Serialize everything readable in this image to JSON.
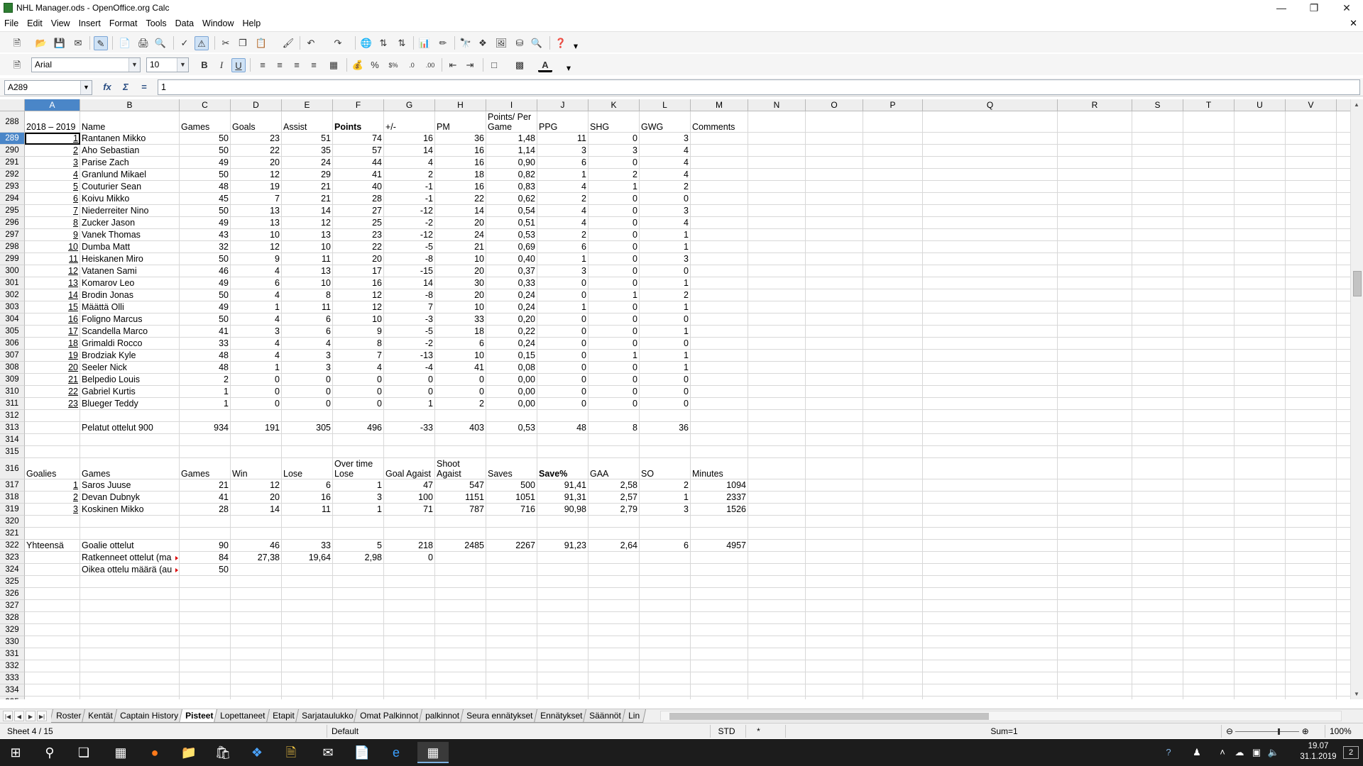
{
  "window": {
    "title": "NHL Manager.ods - OpenOffice.org Calc"
  },
  "menu": [
    "File",
    "Edit",
    "View",
    "Insert",
    "Format",
    "Tools",
    "Data",
    "Window",
    "Help"
  ],
  "format_toolbar": {
    "font_name": "Arial",
    "font_size": "10"
  },
  "formula_bar": {
    "name_box": "A289",
    "content": "1"
  },
  "columns": [
    "A",
    "B",
    "C",
    "D",
    "E",
    "F",
    "G",
    "H",
    "I",
    "J",
    "K",
    "L",
    "M",
    "N",
    "O",
    "P",
    "Q",
    "R",
    "S",
    "T",
    "U",
    "V",
    "W"
  ],
  "rows": [
    {
      "num": "288",
      "cells": [
        "2018 – 2019",
        "Name",
        "Games",
        "Goals",
        "Assist",
        "Points",
        "+/-",
        "PM",
        "Points/ Per Game",
        "PPG",
        "SHG",
        "GWG",
        "Comments"
      ]
    },
    {
      "num": "289",
      "cells": [
        "1",
        "Rantanen Mikko",
        "50",
        "23",
        "51",
        "74",
        "16",
        "36",
        "1,48",
        "11",
        "0",
        "3",
        ""
      ]
    },
    {
      "num": "290",
      "cells": [
        "2",
        "Aho Sebastian",
        "50",
        "22",
        "35",
        "57",
        "14",
        "16",
        "1,14",
        "3",
        "3",
        "4",
        ""
      ]
    },
    {
      "num": "291",
      "cells": [
        "3",
        "Parise Zach",
        "49",
        "20",
        "24",
        "44",
        "4",
        "16",
        "0,90",
        "6",
        "0",
        "4",
        ""
      ]
    },
    {
      "num": "292",
      "cells": [
        "4",
        "Granlund Mikael",
        "50",
        "12",
        "29",
        "41",
        "2",
        "18",
        "0,82",
        "1",
        "2",
        "4",
        ""
      ]
    },
    {
      "num": "293",
      "cells": [
        "5",
        "Couturier Sean",
        "48",
        "19",
        "21",
        "40",
        "-1",
        "16",
        "0,83",
        "4",
        "1",
        "2",
        ""
      ]
    },
    {
      "num": "294",
      "cells": [
        "6",
        "Koivu Mikko",
        "45",
        "7",
        "21",
        "28",
        "-1",
        "22",
        "0,62",
        "2",
        "0",
        "0",
        ""
      ]
    },
    {
      "num": "295",
      "cells": [
        "7",
        "Niederreiter Nino",
        "50",
        "13",
        "14",
        "27",
        "-12",
        "14",
        "0,54",
        "4",
        "0",
        "3",
        ""
      ]
    },
    {
      "num": "296",
      "cells": [
        "8",
        "Zucker Jason",
        "49",
        "13",
        "12",
        "25",
        "-2",
        "20",
        "0,51",
        "4",
        "0",
        "4",
        ""
      ]
    },
    {
      "num": "297",
      "cells": [
        "9",
        "Vanek Thomas",
        "43",
        "10",
        "13",
        "23",
        "-12",
        "24",
        "0,53",
        "2",
        "0",
        "1",
        ""
      ]
    },
    {
      "num": "298",
      "cells": [
        "10",
        "Dumba Matt",
        "32",
        "12",
        "10",
        "22",
        "-5",
        "21",
        "0,69",
        "6",
        "0",
        "1",
        ""
      ]
    },
    {
      "num": "299",
      "cells": [
        "11",
        "Heiskanen Miro",
        "50",
        "9",
        "11",
        "20",
        "-8",
        "10",
        "0,40",
        "1",
        "0",
        "3",
        ""
      ]
    },
    {
      "num": "300",
      "cells": [
        "12",
        "Vatanen Sami",
        "46",
        "4",
        "13",
        "17",
        "-15",
        "20",
        "0,37",
        "3",
        "0",
        "0",
        ""
      ]
    },
    {
      "num": "301",
      "cells": [
        "13",
        "Komarov Leo",
        "49",
        "6",
        "10",
        "16",
        "14",
        "30",
        "0,33",
        "0",
        "0",
        "1",
        ""
      ]
    },
    {
      "num": "302",
      "cells": [
        "14",
        "Brodin Jonas",
        "50",
        "4",
        "8",
        "12",
        "-8",
        "20",
        "0,24",
        "0",
        "1",
        "2",
        ""
      ]
    },
    {
      "num": "303",
      "cells": [
        "15",
        "Määttä Olli",
        "49",
        "1",
        "11",
        "12",
        "7",
        "10",
        "0,24",
        "1",
        "0",
        "1",
        ""
      ]
    },
    {
      "num": "304",
      "cells": [
        "16",
        "Foligno Marcus",
        "50",
        "4",
        "6",
        "10",
        "-3",
        "33",
        "0,20",
        "0",
        "0",
        "0",
        ""
      ]
    },
    {
      "num": "305",
      "cells": [
        "17",
        "Scandella Marco",
        "41",
        "3",
        "6",
        "9",
        "-5",
        "18",
        "0,22",
        "0",
        "0",
        "1",
        ""
      ]
    },
    {
      "num": "306",
      "cells": [
        "18",
        "Grimaldi Rocco",
        "33",
        "4",
        "4",
        "8",
        "-2",
        "6",
        "0,24",
        "0",
        "0",
        "0",
        ""
      ]
    },
    {
      "num": "307",
      "cells": [
        "19",
        "Brodziak Kyle",
        "48",
        "4",
        "3",
        "7",
        "-13",
        "10",
        "0,15",
        "0",
        "1",
        "1",
        ""
      ]
    },
    {
      "num": "308",
      "cells": [
        "20",
        "Seeler Nick",
        "48",
        "1",
        "3",
        "4",
        "-4",
        "41",
        "0,08",
        "0",
        "0",
        "1",
        ""
      ]
    },
    {
      "num": "309",
      "cells": [
        "21",
        "Belpedio Louis",
        "2",
        "0",
        "0",
        "0",
        "0",
        "0",
        "0,00",
        "0",
        "0",
        "0",
        ""
      ]
    },
    {
      "num": "310",
      "cells": [
        "22",
        "Gabriel Kurtis",
        "1",
        "0",
        "0",
        "0",
        "0",
        "0",
        "0,00",
        "0",
        "0",
        "0",
        ""
      ]
    },
    {
      "num": "311",
      "cells": [
        "23",
        "Blueger Teddy",
        "1",
        "0",
        "0",
        "0",
        "1",
        "2",
        "0,00",
        "0",
        "0",
        "0",
        ""
      ]
    },
    {
      "num": "312",
      "cells": [
        "",
        "",
        "",
        "",
        "",
        "",
        "",
        "",
        "",
        "",
        "",
        "",
        ""
      ]
    },
    {
      "num": "313",
      "cells": [
        "",
        "Pelatut ottelut 900",
        "934",
        "191",
        "305",
        "496",
        "-33",
        "403",
        "0,53",
        "48",
        "8",
        "36",
        ""
      ]
    },
    {
      "num": "314",
      "cells": [
        "",
        "",
        "",
        "",
        "",
        "",
        "",
        "",
        "",
        "",
        "",
        "",
        ""
      ]
    },
    {
      "num": "315",
      "cells": [
        "",
        "",
        "",
        "",
        "",
        "",
        "",
        "",
        "",
        "",
        "",
        "",
        ""
      ]
    },
    {
      "num": "316",
      "cells": [
        "Goalies",
        "Games",
        "Games",
        "Win",
        "Lose",
        "Over time Lose",
        "Goal Agaist",
        "Shoot Agaist",
        "Saves",
        "Save%",
        "GAA",
        "SO",
        "Minutes"
      ]
    },
    {
      "num": "317",
      "cells": [
        "1",
        "Saros Juuse",
        "21",
        "12",
        "6",
        "1",
        "47",
        "547",
        "500",
        "91,41",
        "2,58",
        "2",
        "1094"
      ]
    },
    {
      "num": "318",
      "cells": [
        "2",
        "Devan Dubnyk",
        "41",
        "20",
        "16",
        "3",
        "100",
        "1151",
        "1051",
        "91,31",
        "2,57",
        "1",
        "2337"
      ]
    },
    {
      "num": "319",
      "cells": [
        "3",
        "Koskinen Mikko",
        "28",
        "14",
        "11",
        "1",
        "71",
        "787",
        "716",
        "90,98",
        "2,79",
        "3",
        "1526"
      ]
    },
    {
      "num": "320",
      "cells": [
        "",
        "",
        "",
        "",
        "",
        "",
        "",
        "",
        "",
        "",
        "",
        "",
        ""
      ]
    },
    {
      "num": "321",
      "cells": [
        "",
        "",
        "",
        "",
        "",
        "",
        "",
        "",
        "",
        "",
        "",
        "",
        ""
      ]
    },
    {
      "num": "322",
      "cells": [
        "Yhteensä",
        "Goalie ottelut",
        "90",
        "46",
        "33",
        "5",
        "218",
        "2485",
        "2267",
        "91,23",
        "2,64",
        "6",
        "4957"
      ]
    },
    {
      "num": "323",
      "cells": [
        "",
        "Ratkenneet ottelut (ma",
        "84",
        "27,38",
        "19,64",
        "2,98",
        "0",
        "",
        "",
        "",
        "",
        "",
        ""
      ]
    },
    {
      "num": "324",
      "cells": [
        "",
        "Oikea ottelu määrä (au",
        "50",
        "",
        "",
        "",
        "",
        "",
        "",
        "",
        "",
        "",
        ""
      ]
    },
    {
      "num": "325",
      "cells": []
    },
    {
      "num": "326",
      "cells": []
    },
    {
      "num": "327",
      "cells": []
    },
    {
      "num": "328",
      "cells": []
    },
    {
      "num": "329",
      "cells": []
    },
    {
      "num": "330",
      "cells": []
    },
    {
      "num": "331",
      "cells": []
    },
    {
      "num": "332",
      "cells": []
    },
    {
      "num": "333",
      "cells": []
    },
    {
      "num": "334",
      "cells": []
    },
    {
      "num": "335",
      "cells": []
    }
  ],
  "sheet_tabs": [
    "Roster",
    "Kentät",
    "Captain History",
    "Pisteet",
    "Lopettaneet",
    "Etapit",
    "Sarjataulukko",
    "Omat Palkinnot",
    "palkinnot",
    "Seura ennätykset",
    "Ennätykset",
    "Säännöt",
    "Lin"
  ],
  "active_tab": "Pisteet",
  "status": {
    "sheet": "Sheet 4 / 15",
    "page_style": "Default",
    "mode": "STD",
    "modified": "*",
    "sum": "Sum=1",
    "zoom": "100%"
  },
  "taskbar": {
    "time": "19.07",
    "date": "31.1.2019",
    "notifications": "2"
  }
}
